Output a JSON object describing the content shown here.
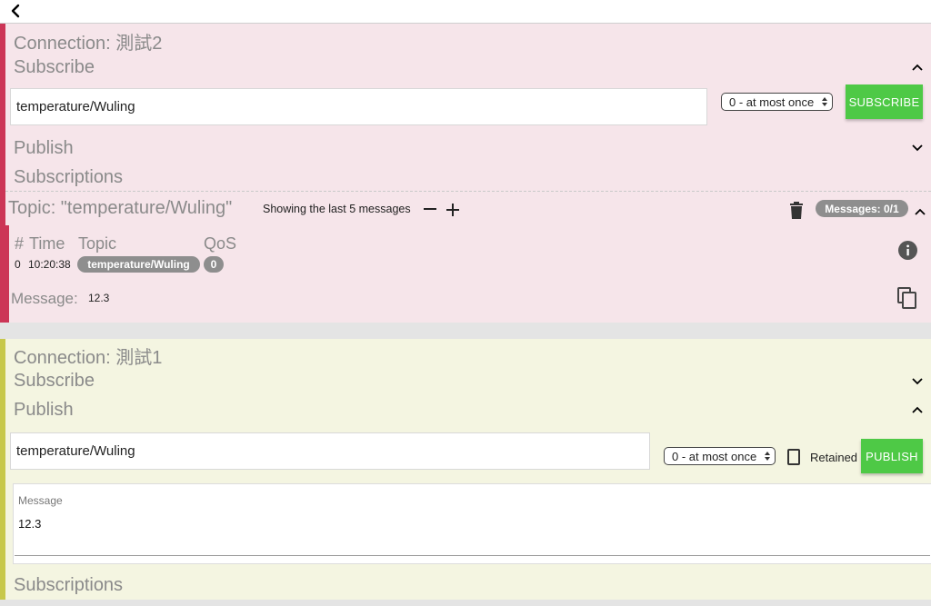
{
  "nav": {
    "back_icon": "chevron-left-icon"
  },
  "connection1": {
    "title": "Connection: 測試2",
    "subscribe_section": "Subscribe",
    "topic_input_value": "temperature/Wuling",
    "qos_selected": "0 - at most once",
    "subscribe_button": "SUBSCRIBE",
    "publish_section": "Publish",
    "subscriptions_section": "Subscriptions",
    "topic_header": "Topic: \"temperature/Wuling\"",
    "showing_text": "Showing the last 5 messages",
    "messages_badge": "Messages: 0/1",
    "columns": {
      "index": "#",
      "time": "Time",
      "topic": "Topic",
      "qos": "QoS"
    },
    "message_row": {
      "index": "0",
      "time": "10:20:38",
      "topic": "temperature/Wuling",
      "qos": "0"
    },
    "message_label": "Message:",
    "message_value": "12.3",
    "accent_color": "#cc3556"
  },
  "connection2": {
    "title": "Connection: 測試1",
    "subscribe_section": "Subscribe",
    "publish_section": "Publish",
    "topic_input_value": "temperature/Wuling",
    "qos_selected": "0 - at most once",
    "retained_label": "Retained",
    "publish_button": "PUBLISH",
    "message_label": "Message",
    "message_value": "12.3",
    "subscriptions_section": "Subscriptions",
    "accent_color": "#c7c84b"
  }
}
